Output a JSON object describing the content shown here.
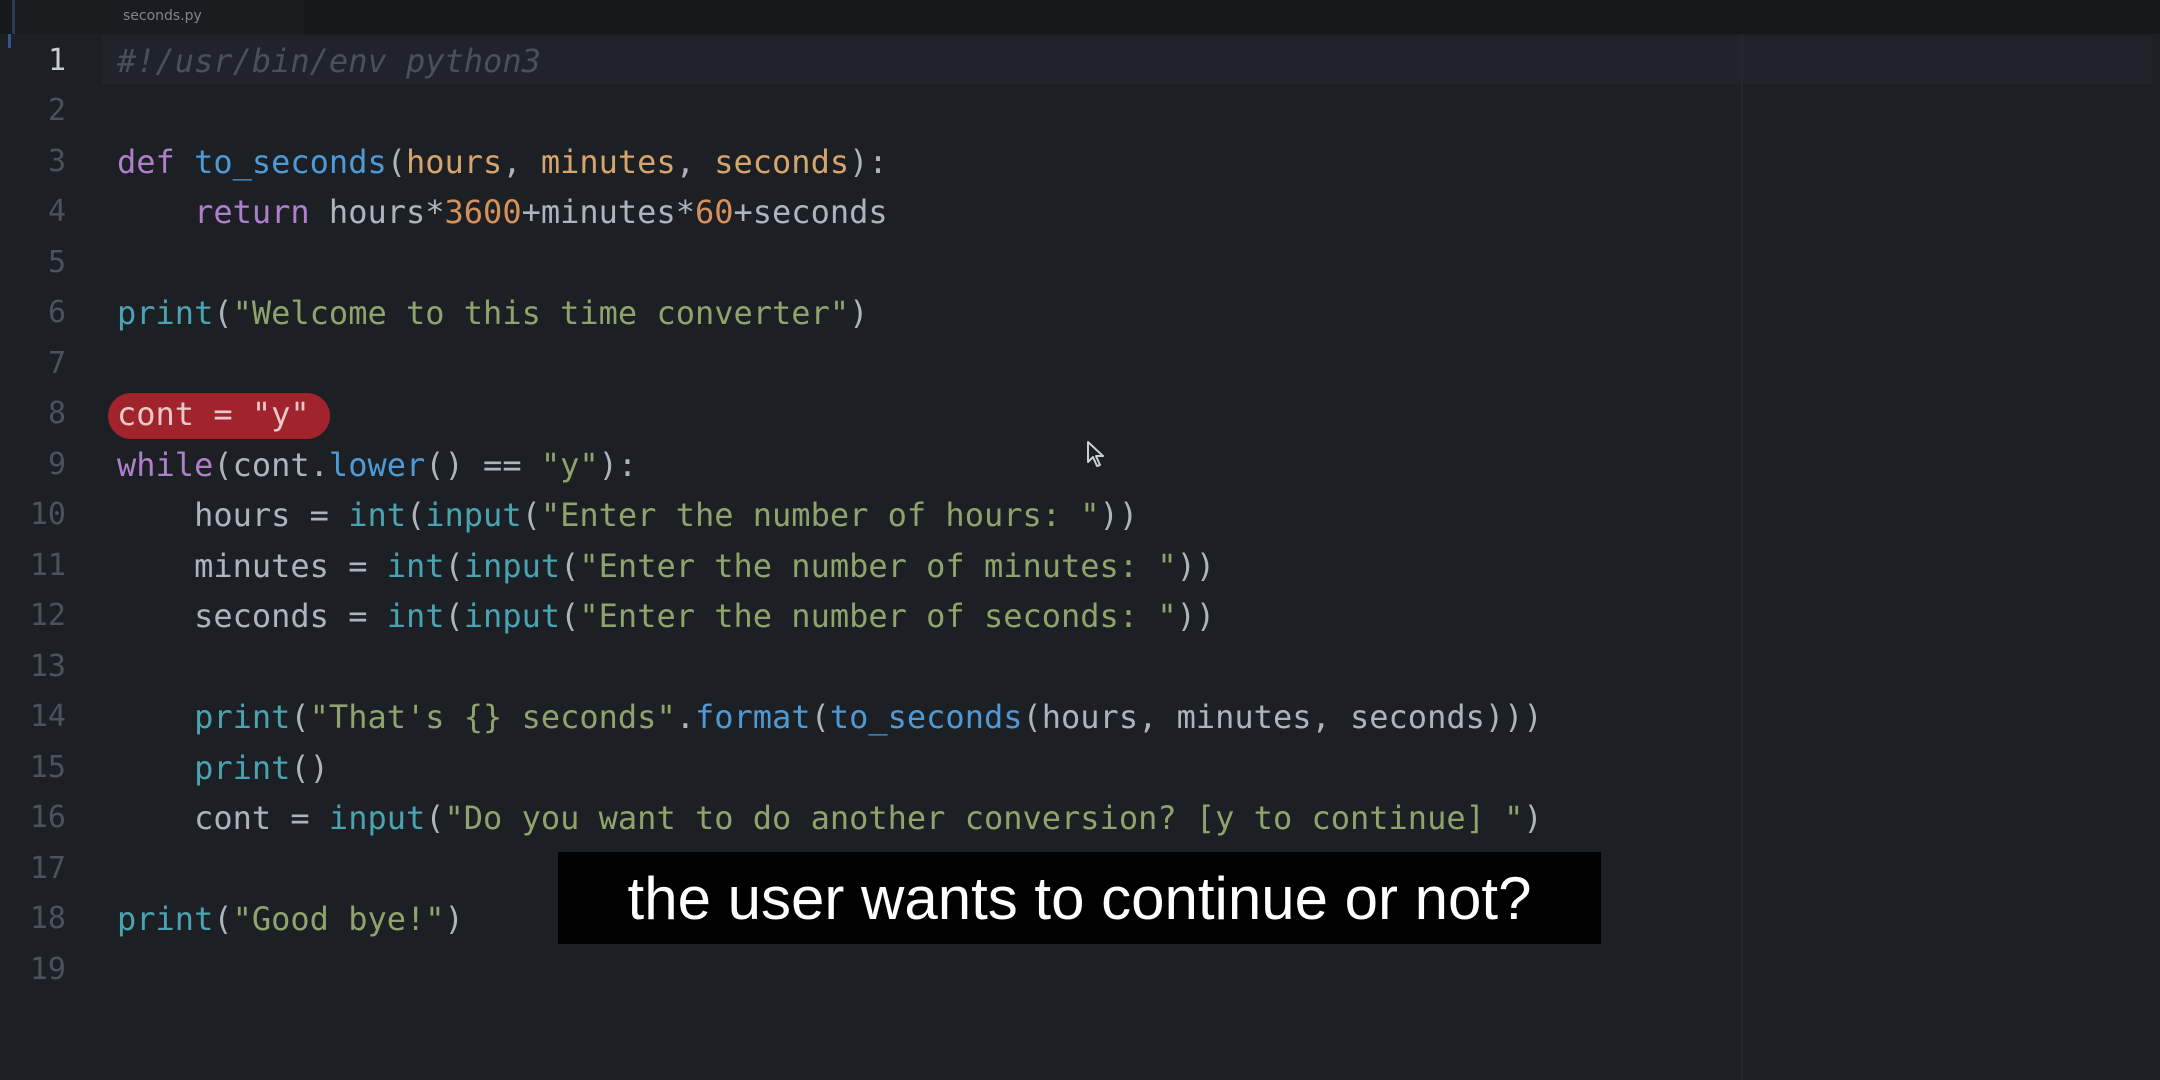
{
  "tab": {
    "filename": "seconds.py"
  },
  "lines": [
    {
      "n": "1",
      "text": "#!/usr/bin/env python3"
    },
    {
      "n": "2",
      "text": ""
    },
    {
      "n": "3",
      "text": "def to_seconds(hours, minutes, seconds):"
    },
    {
      "n": "4",
      "text": "    return hours*3600+minutes*60+seconds"
    },
    {
      "n": "5",
      "text": ""
    },
    {
      "n": "6",
      "text": "print(\"Welcome to this time converter\")"
    },
    {
      "n": "7",
      "text": ""
    },
    {
      "n": "8",
      "text": "cont = \"y\""
    },
    {
      "n": "9",
      "text": "while(cont.lower() == \"y\"):"
    },
    {
      "n": "10",
      "text": "    hours = int(input(\"Enter the number of hours: \"))"
    },
    {
      "n": "11",
      "text": "    minutes = int(input(\"Enter the number of minutes: \"))"
    },
    {
      "n": "12",
      "text": "    seconds = int(input(\"Enter the number of seconds: \"))"
    },
    {
      "n": "13",
      "text": ""
    },
    {
      "n": "14",
      "text": "    print(\"That's {} seconds\".format(to_seconds(hours, minutes, seconds)))"
    },
    {
      "n": "15",
      "text": "    print()"
    },
    {
      "n": "16",
      "text": "    cont = input(\"Do you want to do another conversion? [y to continue] \")"
    },
    {
      "n": "17",
      "text": ""
    },
    {
      "n": "18",
      "text": "print(\"Good bye!\")"
    },
    {
      "n": "19",
      "text": ""
    }
  ],
  "subtitle": "the user wants to continue or not?",
  "colors": {
    "background": "#1c1f24",
    "keyword": "#b07fcc",
    "function": "#4e9ad6",
    "string": "#8ea46c",
    "number": "#d6915a",
    "highlight": "#b8242e"
  },
  "icons": {
    "pointer": "mouse-pointer-icon"
  }
}
